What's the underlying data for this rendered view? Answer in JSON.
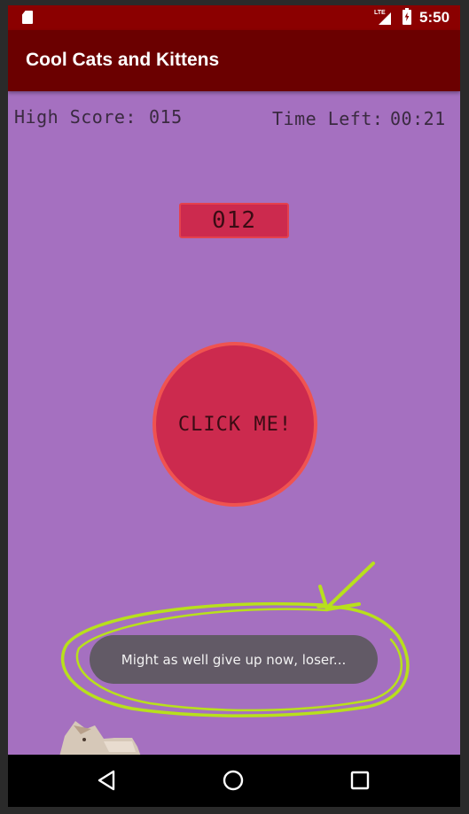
{
  "status_bar": {
    "network_label": "LTE",
    "time": "5:50",
    "icons": [
      "sd-card-icon",
      "signal-icon",
      "battery-charging-icon"
    ]
  },
  "app_bar": {
    "title": "Cool Cats and Kittens"
  },
  "game": {
    "high_score_label": "High Score:",
    "high_score_value": "015",
    "time_left_label": "Time Left:",
    "time_left_value": "00:21",
    "current_score": "012",
    "click_button_label": "CLICK ME!"
  },
  "toast": {
    "message": "Might as well give up now, loser..."
  },
  "nav_bar": {
    "icons": [
      "back-icon",
      "home-icon",
      "recents-icon"
    ]
  },
  "colors": {
    "status_bar": "#8b0000",
    "app_bar": "#6b0000",
    "background": "#a570c0",
    "accent": "#cc2a4e",
    "accent_border": "#ef5350",
    "annotation": "#b8e01c",
    "toast": "#625a66"
  }
}
